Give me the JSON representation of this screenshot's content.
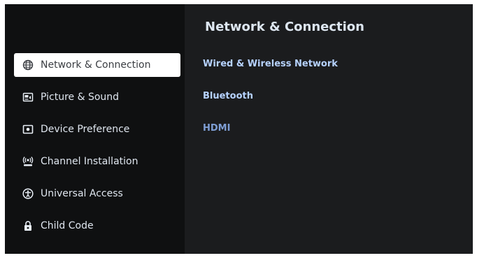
{
  "sidebar": {
    "items": [
      {
        "label": "Network & Connection",
        "icon": "globe-icon",
        "selected": true
      },
      {
        "label": "Picture & Sound",
        "icon": "picture-sound-icon",
        "selected": false
      },
      {
        "label": "Device Preference",
        "icon": "device-icon",
        "selected": false
      },
      {
        "label": "Channel Installation",
        "icon": "antenna-icon",
        "selected": false
      },
      {
        "label": "Universal Access",
        "icon": "accessibility-icon",
        "selected": false
      },
      {
        "label": "Child Code",
        "icon": "lock-icon",
        "selected": false
      }
    ]
  },
  "content": {
    "title": "Network & Connection",
    "options": [
      {
        "label": "Wired & Wireless Network"
      },
      {
        "label": "Bluetooth"
      },
      {
        "label": "HDMI"
      }
    ]
  },
  "colors": {
    "sidebar_bg": "#0f1011",
    "content_bg": "#1b1c1e",
    "selected_bg": "#ffffff",
    "option_text": "#b6d2ff"
  }
}
